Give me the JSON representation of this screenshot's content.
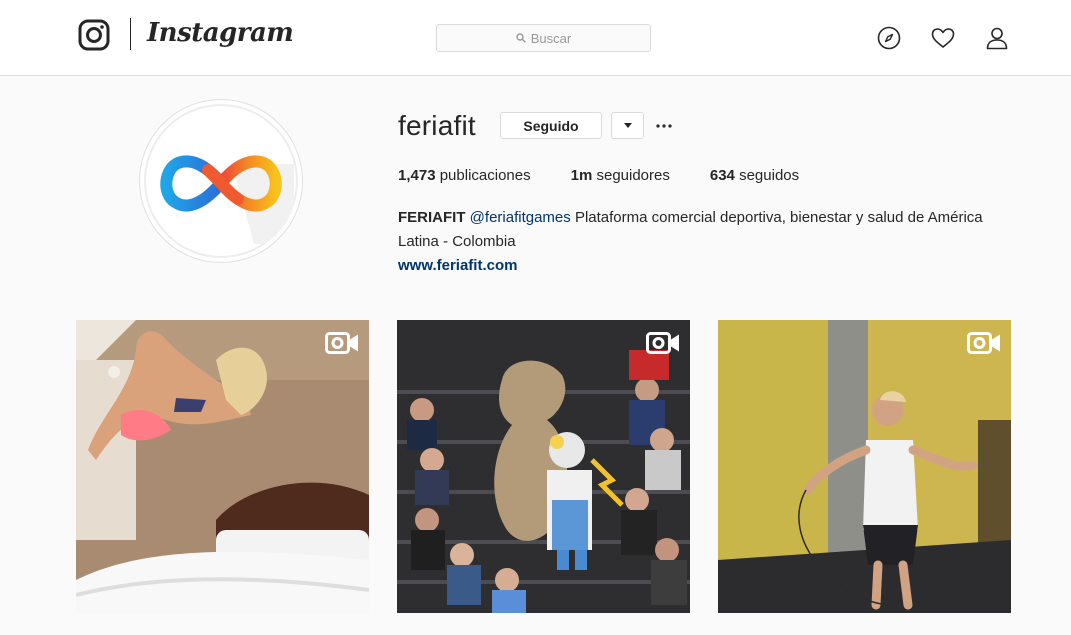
{
  "nav": {
    "brand_icon": "instagram-glyph-icon",
    "wordmark": "Instagram",
    "search_placeholder": "Buscar",
    "icons": [
      "compass-icon",
      "heart-icon",
      "user-icon"
    ]
  },
  "profile": {
    "username": "feriafit",
    "follow_label": "Seguido",
    "stats": {
      "posts_count": "1,473",
      "posts_label": "publicaciones",
      "followers_count": "1m",
      "followers_label": "seguidores",
      "following_count": "634",
      "following_label": "seguidos"
    },
    "bio": {
      "name": "FERIAFIT",
      "mention": "@feriafitgames",
      "text_line1": "Plataforma comercial deportiva, bienestar y salud de América",
      "text_line2": "Latina - Colombia",
      "website": "www.feriafit.com"
    }
  },
  "posts": [
    {
      "type": "video",
      "icon": "video-camera-icon"
    },
    {
      "type": "video",
      "icon": "video-camera-icon"
    },
    {
      "type": "video",
      "icon": "video-camera-icon"
    }
  ],
  "colors": {
    "background": "#fafafa",
    "text": "#262626",
    "link": "#003569",
    "border": "#dbdbdb"
  }
}
